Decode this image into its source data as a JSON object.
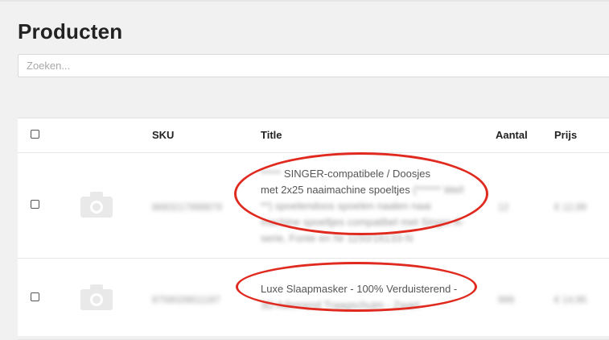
{
  "page": {
    "title": "Producten"
  },
  "search": {
    "placeholder": "Zoeken..."
  },
  "table": {
    "columns": [
      "SKU",
      "Title",
      "Aantal",
      "Prijs"
    ],
    "rows": [
      {
        "sku": "8683217998879",
        "title_lines": [
          {
            "prefix": "***** ",
            "text": "SINGER-compatibele / Doosjes"
          },
          {
            "text": "met 2x25 naaimachine spoeltjes",
            "suffix": " (****** Wel!"
          },
          {
            "text": "**) spoelendoos spoelen naalen naai"
          },
          {
            "text": "machine spoeltjes compatibel met Singer A-"
          },
          {
            "text": "serie, Fonte en Nr 1150/16133-N"
          }
        ],
        "aantal": "12",
        "prijs": "€ 12,99"
      },
      {
        "sku": "8758028811187",
        "title_lines": [
          {
            "text": "Luxe Slaapmasker - 100% Verduisterend -"
          },
          {
            "text": "3D Ademend Traagschuim - Zwart"
          }
        ],
        "aantal": "999",
        "prijs": "€ 14,95"
      }
    ]
  },
  "icons": {
    "row_image": "camera-icon"
  },
  "colors": {
    "annotation": "#e02a1f"
  }
}
